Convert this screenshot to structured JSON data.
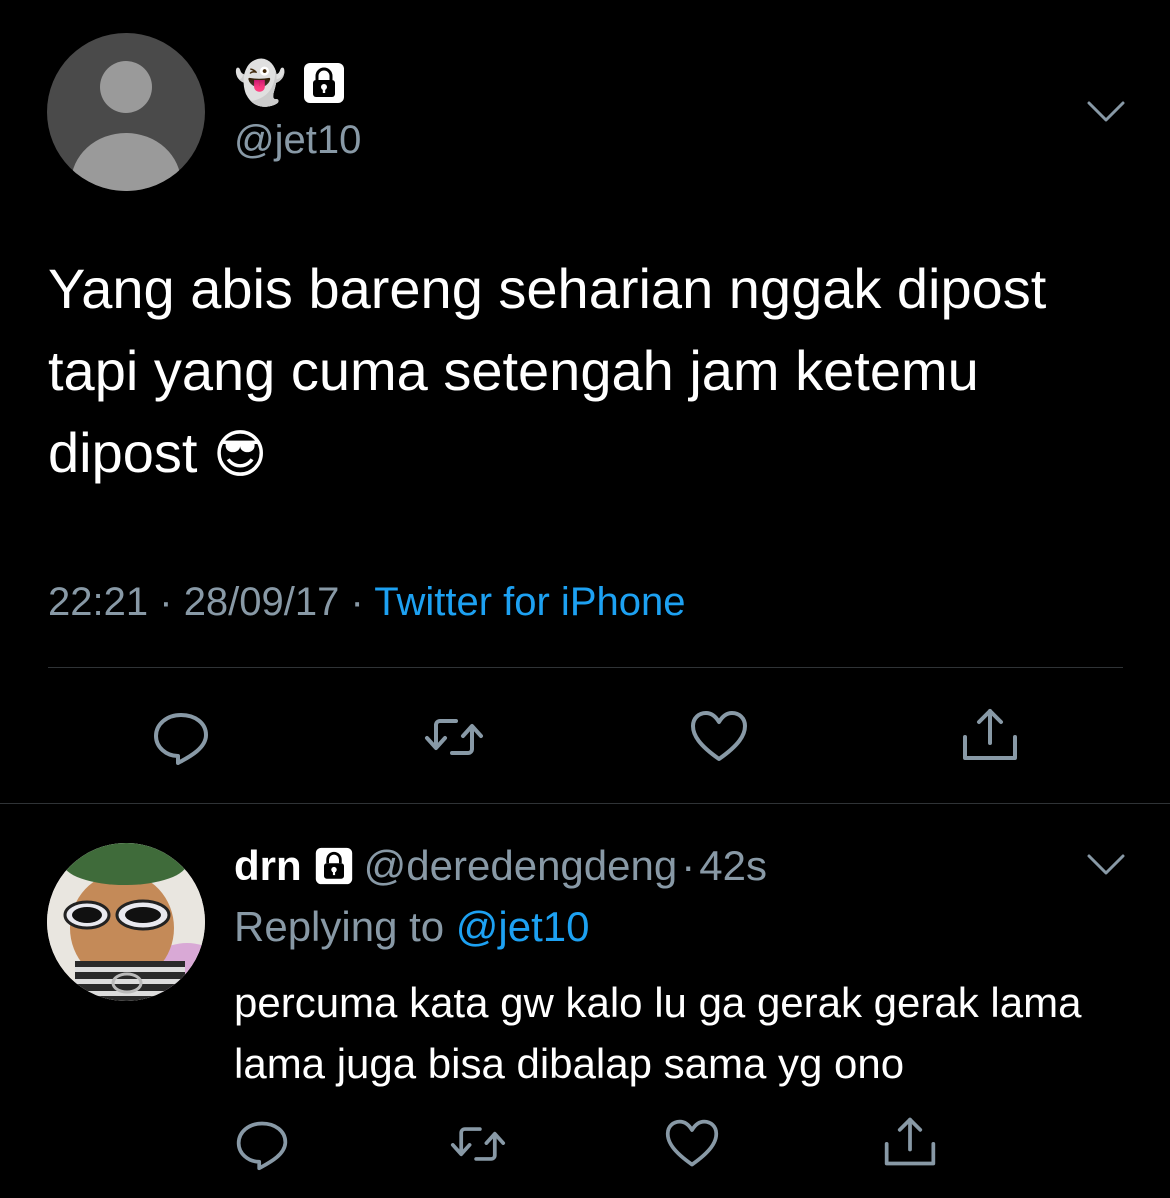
{
  "main_tweet": {
    "display_emoji": "👻",
    "handle": "@jet10",
    "text": "Yang abis bareng seharian nggak dipost tapi yang cuma setengah jam ketemu dipost",
    "text_emoji": "😎",
    "time": "22:21",
    "date": "28/09/17",
    "separator": "·",
    "source": "Twitter for iPhone",
    "actions": [
      "comment-icon",
      "retweet-icon",
      "like-icon",
      "share-icon"
    ]
  },
  "reply": {
    "name": "drn",
    "handle": "@deredengdeng",
    "separator": "·",
    "age": "42s",
    "replying_prefix": "Replying to",
    "replying_handle": "@jet10",
    "text": "percuma kata gw kalo lu ga gerak gerak lama lama juga bisa dibalap sama yg ono",
    "actions": [
      "comment-icon",
      "retweet-icon",
      "like-icon",
      "share-icon"
    ]
  },
  "colors": {
    "background": "#000000",
    "text": "#ffffff",
    "secondary": "#8899a6",
    "link": "#1da1f2",
    "divider": "#2f3336"
  }
}
